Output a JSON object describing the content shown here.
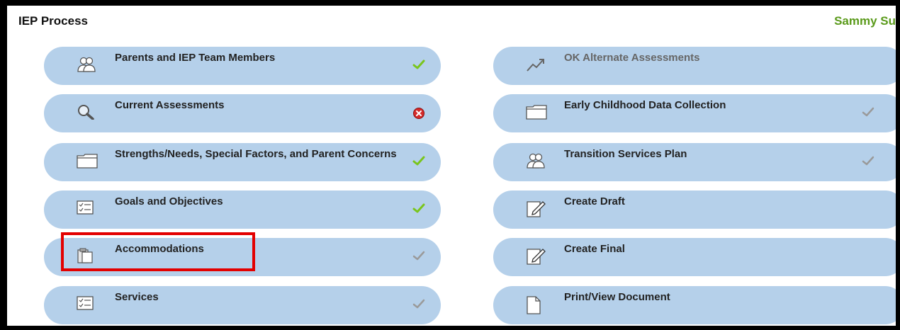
{
  "header": {
    "title": "IEP Process",
    "user": "Sammy Su"
  },
  "left_items": [
    {
      "label": "Parents and IEP Team Members",
      "icon": "people-icon",
      "status": "complete-check"
    },
    {
      "label": "Current Assessments",
      "icon": "magnifier-icon",
      "status": "error-x"
    },
    {
      "label": "Strengths/Needs, Special Factors, and Parent Concerns",
      "icon": "folder-icon",
      "status": "complete-check"
    },
    {
      "label": "Goals and Objectives",
      "icon": "checklist-icon",
      "status": "complete-check"
    },
    {
      "label": "Accommodations",
      "icon": "clipboard-icon",
      "status": "gray-check"
    },
    {
      "label": "Services",
      "icon": "checklist-icon",
      "status": "gray-check"
    }
  ],
  "right_items": [
    {
      "label": "OK Alternate Assessments",
      "icon": "trend-arrow-icon",
      "status": "none",
      "disabled": true
    },
    {
      "label": "Early Childhood Data Collection",
      "icon": "folder-icon",
      "status": "gray-check"
    },
    {
      "label": "Transition Services Plan",
      "icon": "people-icon",
      "status": "gray-check"
    },
    {
      "label": "Create Draft",
      "icon": "edit-doc-icon",
      "status": "none"
    },
    {
      "label": "Create Final",
      "icon": "edit-doc-icon",
      "status": "none"
    },
    {
      "label": "Print/View Document",
      "icon": "document-icon",
      "status": "none"
    }
  ],
  "colors": {
    "pill": "#b5d0ea",
    "user": "#5a9a1a",
    "highlight": "#e30000",
    "check_green": "#7ac51c",
    "error_red": "#d42a2a"
  }
}
